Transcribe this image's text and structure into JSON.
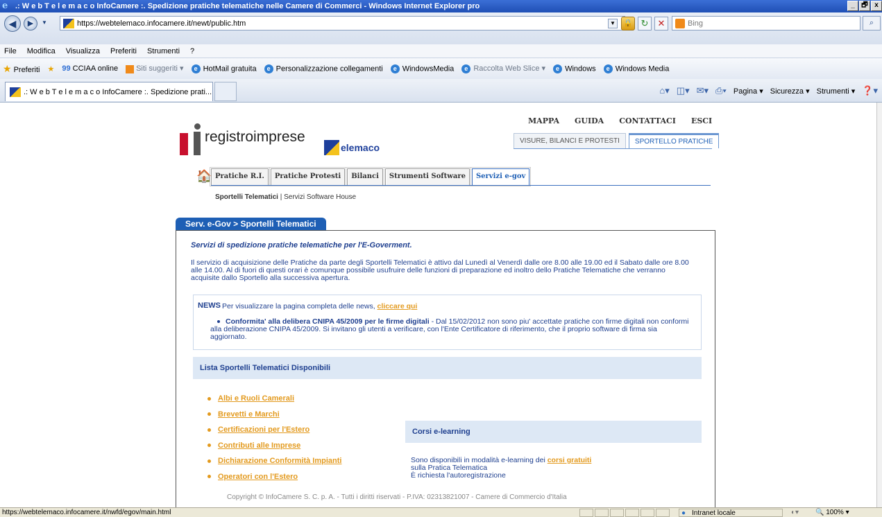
{
  "window": {
    "title": ".: W e b T e l e m a c o InfoCamere :. Spedizione pratiche telematiche nelle Camere di Commerci - Windows Internet Explorer pro",
    "minimize": "_",
    "maximize": "🗗",
    "close": "x"
  },
  "addressbar": {
    "url": "https://webtelemaco.infocamere.it/newt/public.htm",
    "search_placeholder": "Bing"
  },
  "menubar": [
    "File",
    "Modifica",
    "Visualizza",
    "Preferiti",
    "Strumenti",
    "?"
  ],
  "favorites": {
    "label": "Preferiti",
    "items": [
      {
        "label": "CCIAA online",
        "dim": false
      },
      {
        "label": "Siti suggeriti ▾",
        "dim": true
      },
      {
        "label": "HotMail gratuita",
        "dim": false
      },
      {
        "label": "Personalizzazione collegamenti",
        "dim": false
      },
      {
        "label": "WindowsMedia",
        "dim": false
      },
      {
        "label": "Raccolta Web Slice ▾",
        "dim": true
      },
      {
        "label": "Windows",
        "dim": false
      },
      {
        "label": "Windows Media",
        "dim": false
      }
    ]
  },
  "tabbar": {
    "tab_title": ".: W e b T e l e m a c o InfoCamere :. Spedizione prati...",
    "commands": [
      "Pagina ▾",
      "Sicurezza ▾",
      "Strumenti ▾"
    ]
  },
  "site": {
    "logo_text": "registroimprese",
    "telemaco_text": "elemaco",
    "top_links": [
      "MAPPA",
      "GUIDA",
      "CONTATTACI",
      "ESCI"
    ],
    "section_tabs": [
      {
        "label": "VISURE, BILANCI E PROTESTI",
        "active": false
      },
      {
        "label": "SPORTELLO PRATICHE",
        "active": true
      }
    ],
    "main_tabs": [
      {
        "label": "Pratiche R.I.",
        "active": false
      },
      {
        "label": "Pratiche Protesti",
        "active": false
      },
      {
        "label": "Bilanci",
        "active": false
      },
      {
        "label": "Strumenti Software",
        "active": false
      },
      {
        "label": "Servizi e-gov",
        "active": true
      }
    ],
    "subnav_active": "Sportelli Telematici",
    "subnav_sep": " | ",
    "subnav_other": "Servizi Software House"
  },
  "content": {
    "box_title": "Serv. e-Gov > Sportelli Telematici",
    "intro_title": "Servizi di spedizione pratiche telematiche per l'E-Goverment.",
    "intro_text": "Il servizio di acquisizione delle Pratiche da parte degli Sportelli Telematici è attivo dal Lunedì al Venerdì dalle ore 8.00 alle 19.00 ed il Sabato dalle ore 8.00 alle 14.00. Al di fuori di questi orari è comunque possibile usufruire delle funzioni di preparazione ed inoltro dello Pratiche Telematiche che verranno acquisite dallo Sportello alla successiva apertura.",
    "news_label": "NEWS",
    "news_line": "Per visualizzare la pagina completa delle news,",
    "news_link": "cliccare qui",
    "news_item_title": "Conformita' alla delibera CNIPA 45/2009 per le firme digitali",
    "news_item_text": " - Dal 15/02/2012 non sono piu' accettate pratiche con firme digitali non conformi alla deliberazione CNIPA 45/2009. Si invitano gli utenti a verificare, con l'Ente Certificatore di riferimento, che il proprio software di firma sia aggiornato.",
    "list_title": "Lista Sportelli Telematici Disponibili",
    "list_items": [
      "Albi e Ruoli Camerali",
      "Brevetti e Marchi",
      "Certificazioni per l'Estero",
      "Contributi alle Imprese",
      "Dichiarazione Conformità Impianti",
      "Operatori con l'Estero"
    ],
    "corsi_title": "Corsi e-learning",
    "corsi_line1": "Sono disponibili in modalità e-learning dei",
    "corsi_link": "corsi gratuiti",
    "corsi_line2": "sulla Pratica Telematica",
    "corsi_line3": "È richiesta l'autoregistrazione",
    "copyright": "Copyright © InfoCamere S. C. p. A. - Tutti i diritti riservati - P.IVA: 02313821007 - Camere di Commercio d'Italia"
  },
  "statusbar": {
    "url": "https://webtelemaco.infocamere.it/nwfd/egov/main.html",
    "zone": "Intranet locale",
    "zoom": "100%"
  }
}
